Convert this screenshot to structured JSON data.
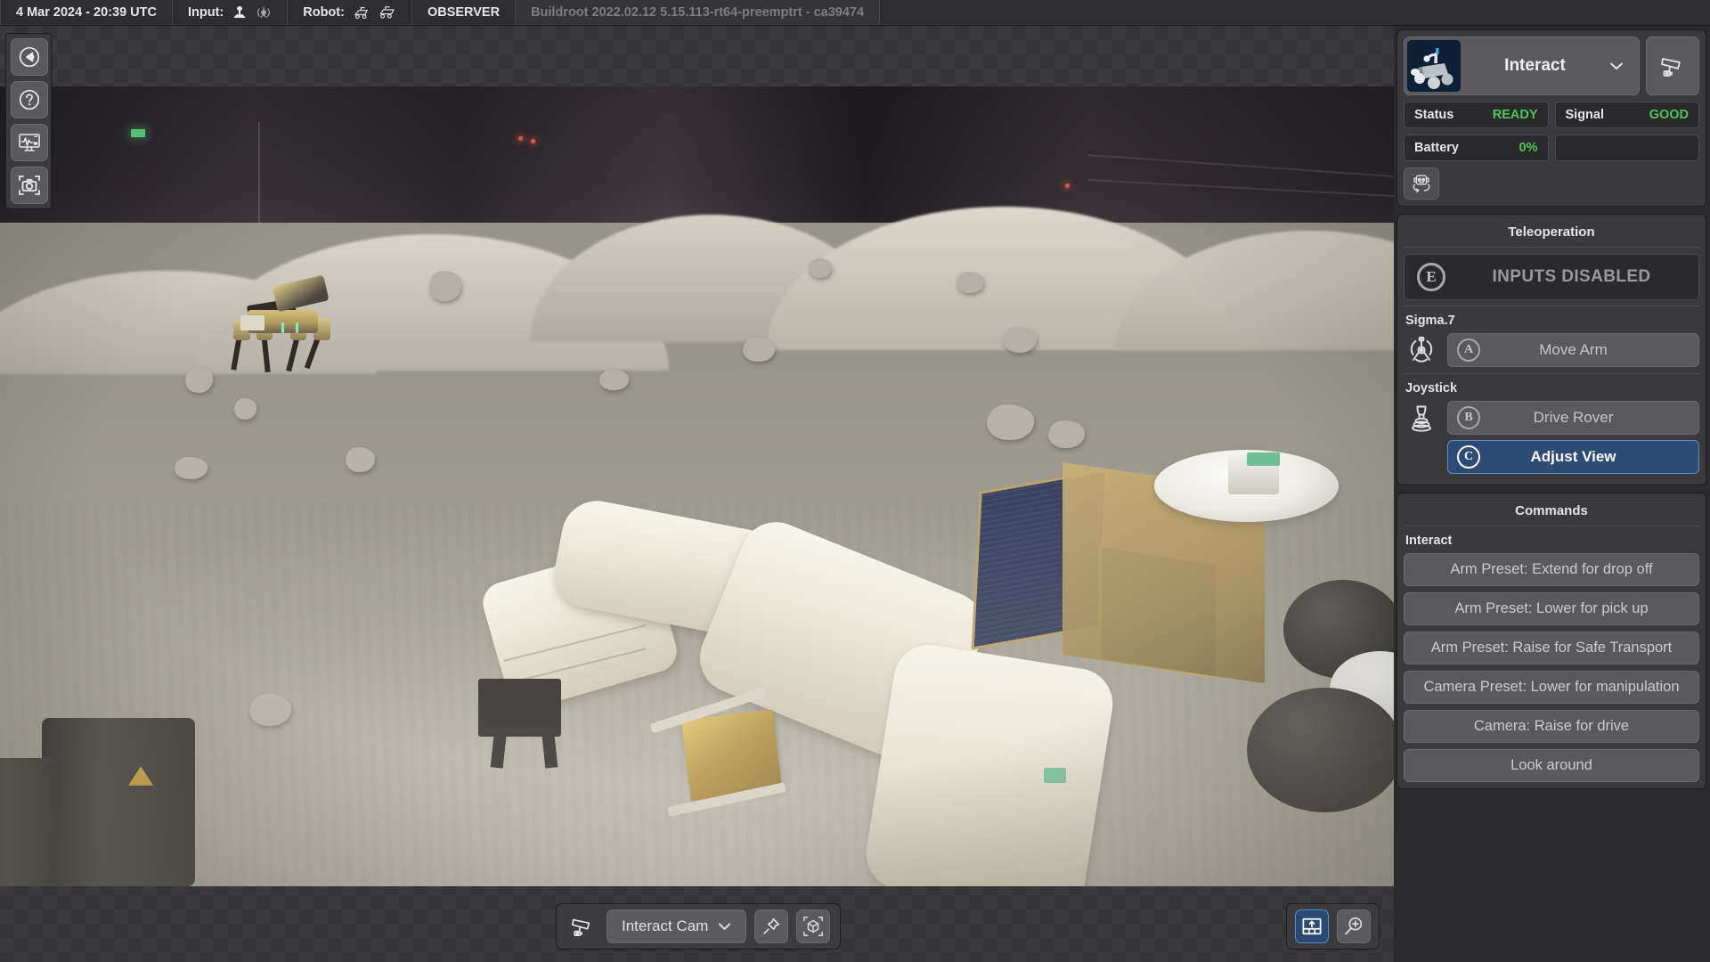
{
  "topbar": {
    "timestamp": "4 Mar 2024 - 20:39 UTC",
    "input_label": "Input:",
    "input_icons": [
      "joystick-icon",
      "sigma7-haptic-icon"
    ],
    "robot_label": "Robot:",
    "robot_icons": [
      "rover-icon",
      "rover-icon"
    ],
    "role": "OBSERVER",
    "build_info": "Buildroot 2022.02.12 5.15.113-rt64-preemptrt - ca39474"
  },
  "left_rail": {
    "items": [
      {
        "name": "back-arrow-icon",
        "tooltip": "Back"
      },
      {
        "name": "help-icon",
        "tooltip": "Help"
      },
      {
        "name": "telemetry-monitor-icon",
        "tooltip": "Telemetry"
      },
      {
        "name": "screenshot-icon",
        "tooltip": "Screenshot"
      }
    ]
  },
  "sidebar": {
    "robot": {
      "name": "Interact",
      "thumbnail": "rover-thumbnail",
      "chevron": "chevron-down-icon",
      "camera_button": "camera-icon",
      "mode_button": "robot-head-rotate-icon"
    },
    "stats": [
      {
        "key": "Status",
        "value": "READY"
      },
      {
        "key": "Signal",
        "value": "GOOD"
      },
      {
        "key": "Battery",
        "value": "0%"
      },
      {
        "key": "",
        "value": ""
      }
    ],
    "teleoperation": {
      "title": "Teleoperation",
      "inputs_state": "INPUTS DISABLED",
      "inputs_badge": "E",
      "devices": [
        {
          "label": "Sigma.7",
          "icon": "sigma7-haptic-icon",
          "actions": [
            {
              "badge": "A",
              "label": "Move Arm",
              "selected": false
            }
          ]
        },
        {
          "label": "Joystick",
          "icon": "joystick-icon",
          "actions": [
            {
              "badge": "B",
              "label": "Drive Rover",
              "selected": false
            },
            {
              "badge": "C",
              "label": "Adjust View",
              "selected": true
            }
          ]
        }
      ]
    },
    "commands": {
      "title": "Commands",
      "group_label": "Interact",
      "buttons": [
        "Arm Preset: Extend for drop off",
        "Arm Preset: Lower for pick up",
        "Arm Preset: Raise for Safe Transport",
        "Camera Preset: Lower for manipulation",
        "Camera: Raise for drive",
        "Look around"
      ]
    }
  },
  "bottom_bar": {
    "camera_icon": "camera-icon",
    "camera_selected": "Interact Cam",
    "camera_chevron": "chevron-down-icon",
    "pin_button": "pin-icon",
    "cube_button": "3d-view-icon",
    "layout_button": "panel-layout-icon",
    "zoom_button": "zoom-in-icon"
  },
  "colors": {
    "accent_blue": "#2c4b75",
    "accent_blue_border": "#5f8fc4",
    "status_green": "#52c45b",
    "panel_bg": "#3a3a3c",
    "panel_dark": "#2a2a2c",
    "button_bg": "#5a5a5e",
    "topbar_bg": "#2e2e30",
    "text_primary": "#e6e6e8",
    "text_muted": "#7d7d82"
  },
  "scene": {
    "description": "lunar-analog-testbed-camera-feed",
    "subjects": [
      "quadruped-robot",
      "rover-with-arm",
      "regolith-terrain",
      "rocks"
    ]
  }
}
